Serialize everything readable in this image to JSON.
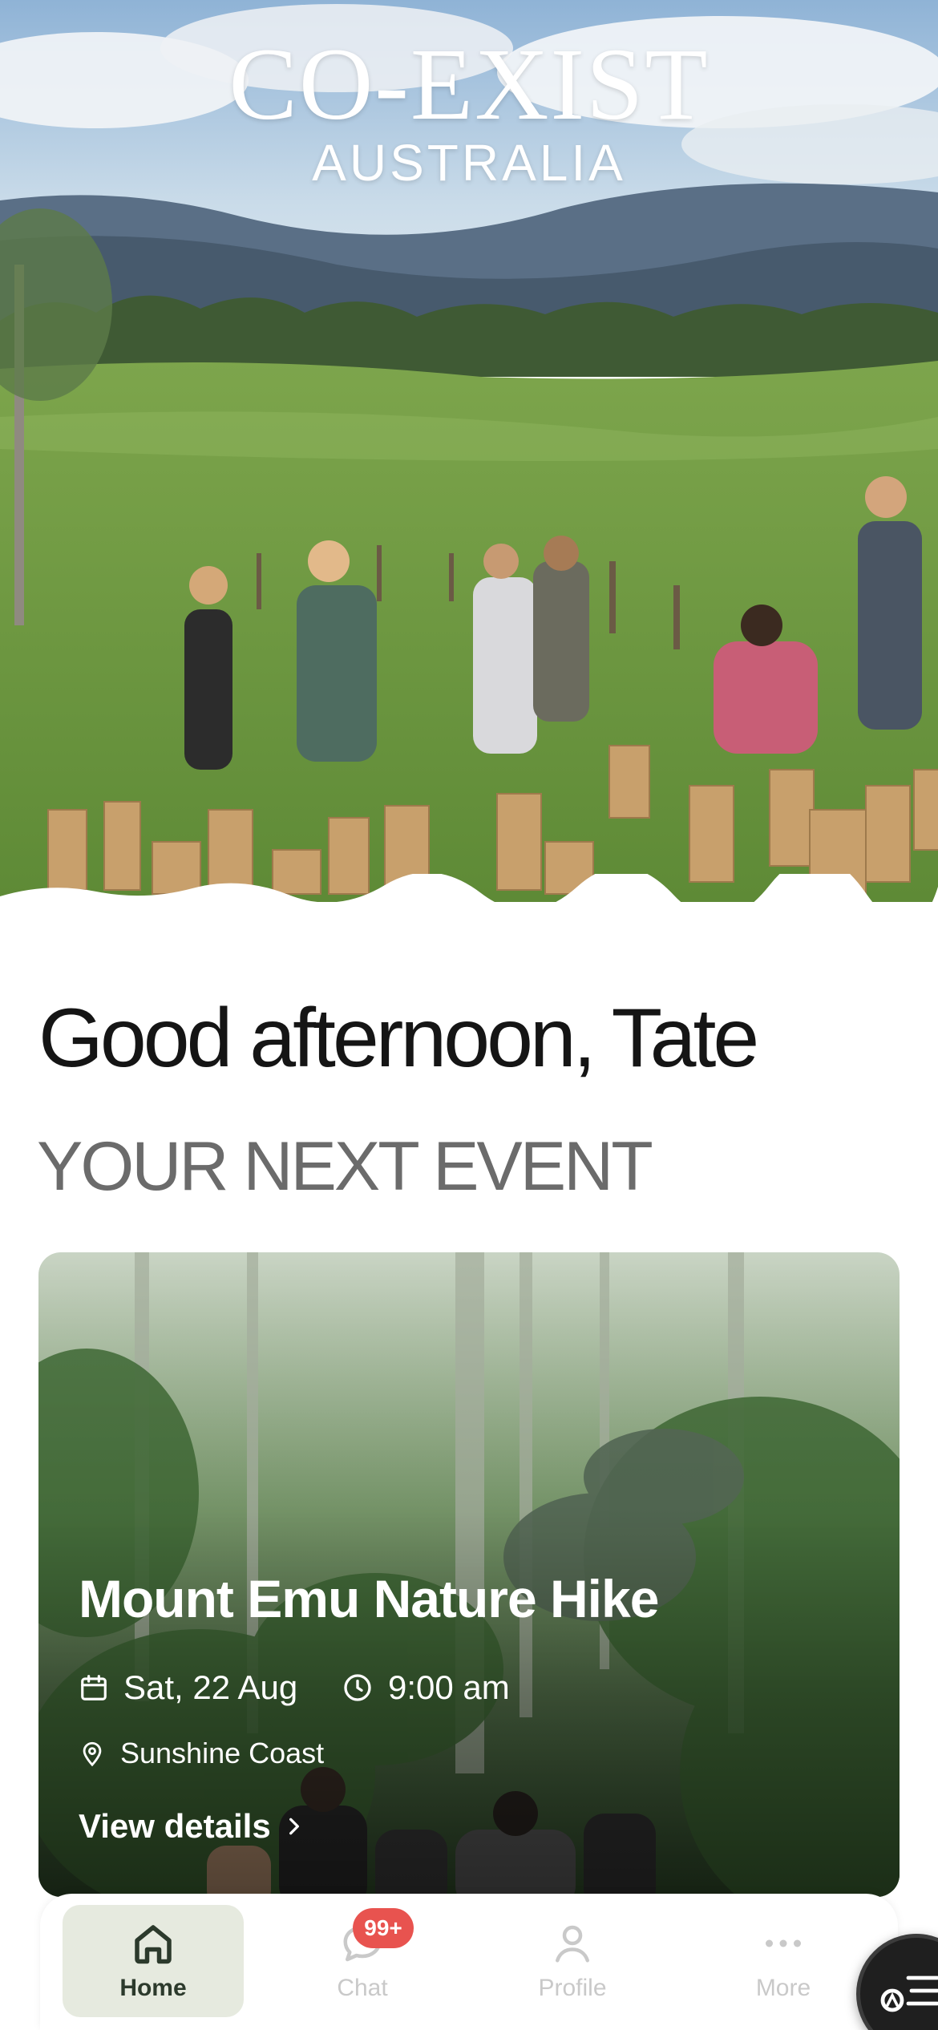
{
  "brand": {
    "line1": "CO-EXIST",
    "line2": "AUSTRALIA"
  },
  "greeting": "Good afternoon, Tate",
  "section_title": "YOUR NEXT EVENT",
  "event": {
    "title": "Mount Emu Nature Hike",
    "date": "Sat, 22 Aug",
    "time": "9:00 am",
    "location": "Sunshine Coast",
    "cta": "View details"
  },
  "nav": {
    "items": [
      {
        "label": "Home",
        "icon": "home-icon",
        "active": true
      },
      {
        "label": "Chat",
        "icon": "chat-icon",
        "active": false
      },
      {
        "label": "Profile",
        "icon": "profile-icon",
        "active": false
      },
      {
        "label": "More",
        "icon": "more-icon",
        "active": false
      }
    ],
    "chat_badge": "99+"
  },
  "colors": {
    "accent_active_bg": "#e6eadf",
    "badge": "#e8534f",
    "fab": "#1f1f1f"
  }
}
